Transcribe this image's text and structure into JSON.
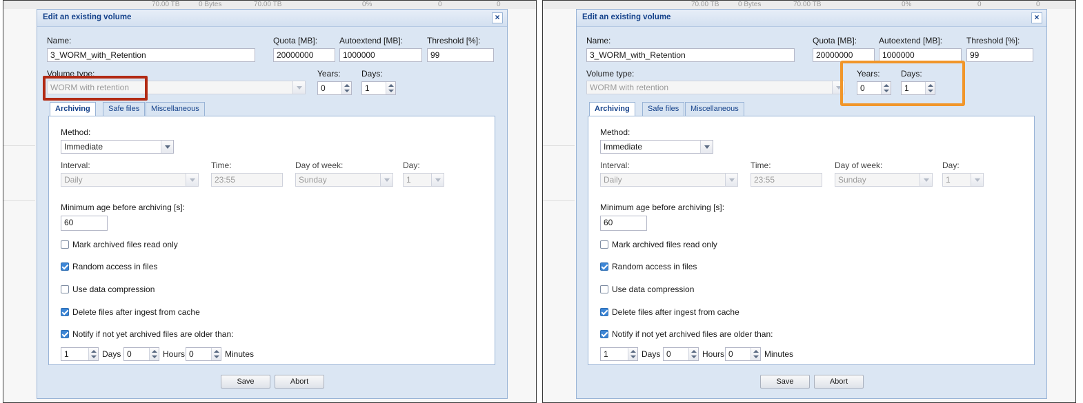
{
  "background_row": {
    "values": [
      "70.00 TB",
      "0 Bytes",
      "70.00 TB",
      "0%",
      "0",
      "0"
    ]
  },
  "dialog": {
    "title": "Edit an existing volume",
    "close_glyph": "×",
    "name": {
      "label": "Name:",
      "value": "3_WORM_with_Retention"
    },
    "quota": {
      "label": "Quota [MB]:",
      "value": "20000000"
    },
    "autoextend": {
      "label": "Autoextend [MB]:",
      "value": "1000000"
    },
    "threshold": {
      "label": "Threshold [%]:",
      "value": "99"
    },
    "volume_type": {
      "label": "Volume type:",
      "value": "WORM with retention"
    },
    "years": {
      "label": "Years:",
      "value": "0"
    },
    "days": {
      "label": "Days:",
      "value": "1"
    },
    "tabs": [
      {
        "label": "Archiving",
        "active": true
      },
      {
        "label": "Safe files",
        "active": false
      },
      {
        "label": "Miscellaneous",
        "active": false
      }
    ],
    "archiving": {
      "method": {
        "label": "Method:",
        "value": "Immediate"
      },
      "interval": {
        "label": "Interval:",
        "value": "Daily"
      },
      "time": {
        "label": "Time:",
        "value": "23:55"
      },
      "day_of_week": {
        "label": "Day of week:",
        "value": "Sunday"
      },
      "day": {
        "label": "Day:",
        "value": "1"
      },
      "min_age": {
        "label": "Minimum age before archiving [s]:",
        "value": "60"
      },
      "checkboxes": [
        {
          "label": "Mark archived files read only",
          "checked": false
        },
        {
          "label": "Random access in files",
          "checked": true
        },
        {
          "label": "Use data compression",
          "checked": false
        },
        {
          "label": "Delete files after ingest from cache",
          "checked": true
        },
        {
          "label": "Notify if not yet archived files are older than:",
          "checked": true
        }
      ],
      "notify": {
        "days_value": "1",
        "days_label": "Days",
        "hours_value": "0",
        "hours_label": "Hours",
        "minutes_value": "0",
        "minutes_label": "Minutes"
      }
    },
    "buttons": {
      "save": "Save",
      "abort": "Abort"
    }
  },
  "colors": {
    "highlight_left": "#b22a14",
    "highlight_right": "#f1962a",
    "title_text": "#15428b",
    "dialog_bg": "#dbe6f3"
  }
}
